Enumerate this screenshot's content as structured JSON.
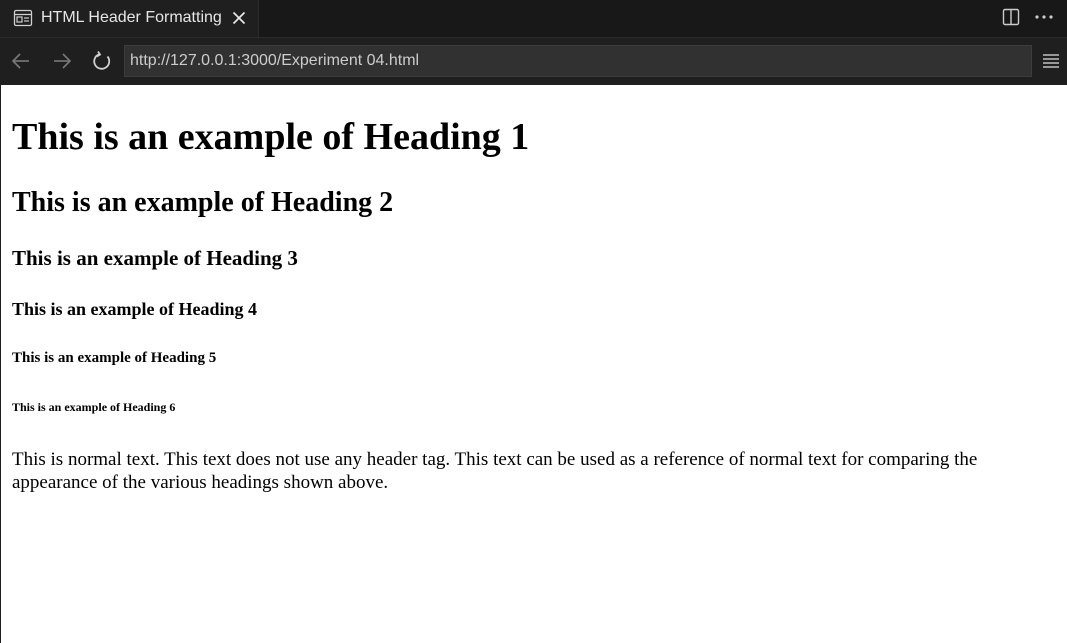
{
  "tab": {
    "title": "HTML Header Formatting",
    "icon": "preview-icon",
    "close_icon": "close-icon"
  },
  "toolbar_right": {
    "split_icon": "split-editor-icon",
    "more_icon": "more-actions-icon"
  },
  "navigation": {
    "back_icon": "arrow-left-icon",
    "forward_icon": "arrow-right-icon",
    "reload_icon": "reload-icon",
    "url": "http://127.0.0.1:3000/Experiment 04.html",
    "menu_icon": "hamburger-menu-icon"
  },
  "page": {
    "heading1": "This is an example of Heading 1",
    "heading2": "This is an example of Heading 2",
    "heading3": "This is an example of Heading 3",
    "heading4": "This is an example of Heading 4",
    "heading5": "This is an example of Heading 5",
    "heading6": "This is an example of Heading 6",
    "normal_text": "This is normal text. This text does not use any header tag. This text can be used as a reference of normal text for comparing the appearance of the various headings shown above."
  },
  "colors": {
    "chrome_dark": "#1f1f1f",
    "tabbar": "#181818",
    "url_field": "#313131",
    "chrome_text": "#cccccc",
    "page_bg": "#ffffff",
    "page_text": "#000000"
  }
}
